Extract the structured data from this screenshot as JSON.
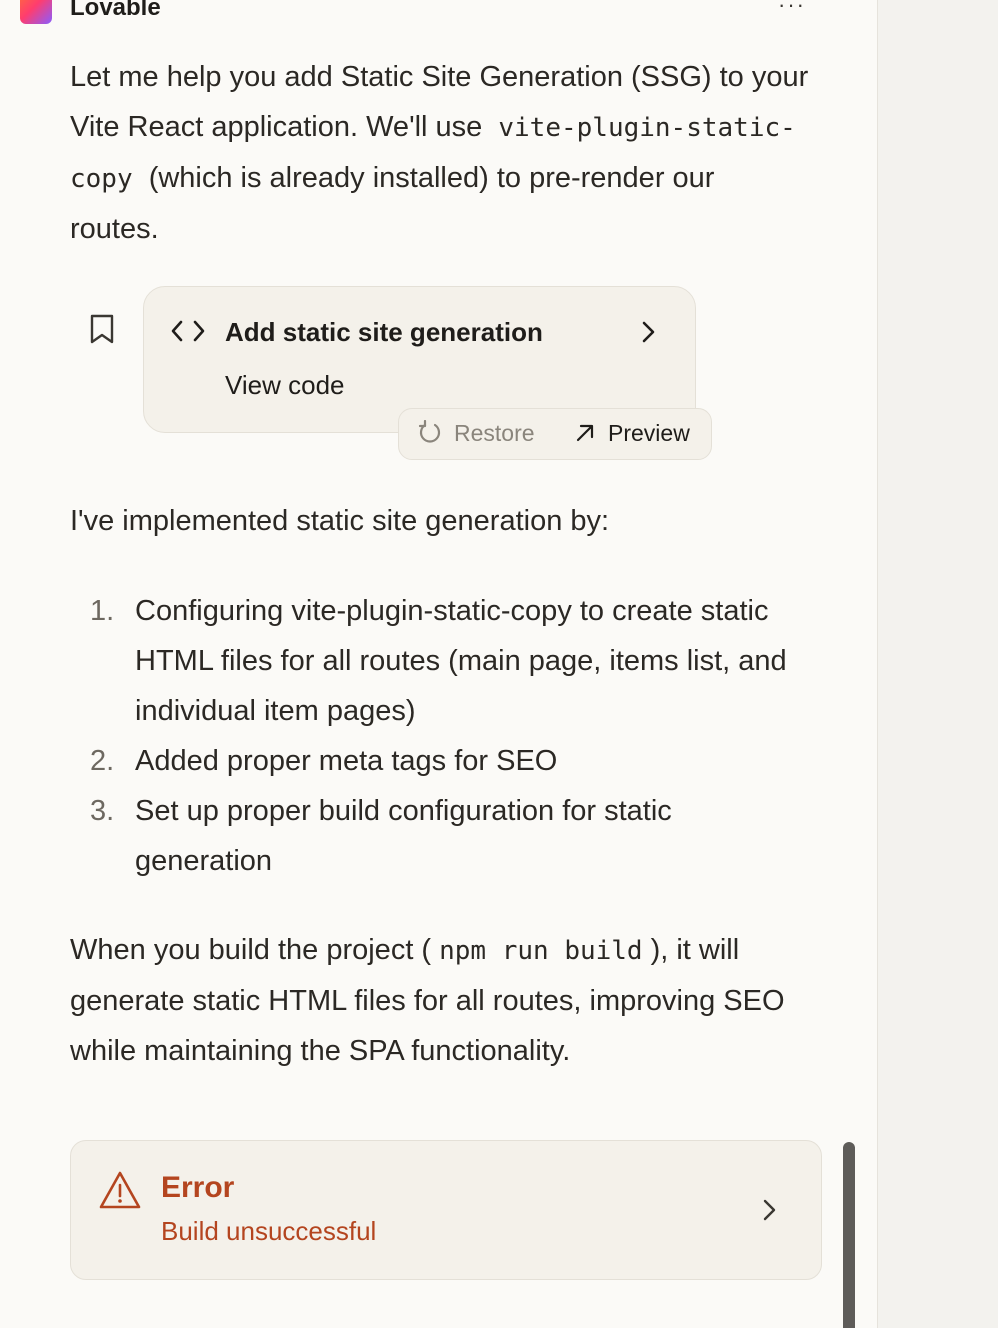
{
  "header": {
    "brand": "Lovable",
    "more_label": "···"
  },
  "message": {
    "intro": {
      "text1": "Let me help you add Static Site Generation (SSG) to your Vite React application. We'll use",
      "code1": "vite-plugin-static-copy",
      "text2": "(which is already installed) to pre-render our routes."
    },
    "code_card": {
      "title": "Add static site generation",
      "subtitle": "View code",
      "restore_label": "Restore",
      "preview_label": "Preview"
    },
    "summary": "I've implemented static site generation by:",
    "steps": [
      {
        "num": "1.",
        "text": "Configuring vite-plugin-static-copy to create static HTML files for all routes (main page, items list, and individual item pages)"
      },
      {
        "num": "2.",
        "text": "Added proper meta tags for SEO"
      },
      {
        "num": "3.",
        "text": "Set up proper build configuration for static generation"
      }
    ],
    "closing": {
      "text1": "When you build the project (",
      "code": "npm run build",
      "text2": "), it will generate static HTML files for all routes, improving SEO while maintaining the SPA functionality."
    }
  },
  "error_card": {
    "title": "Error",
    "subtitle": "Build unsuccessful"
  },
  "colors": {
    "error": "#b4451f",
    "card_bg": "#f4f1ea",
    "pane_bg": "#fbfaf7",
    "muted": "#8a857c"
  }
}
